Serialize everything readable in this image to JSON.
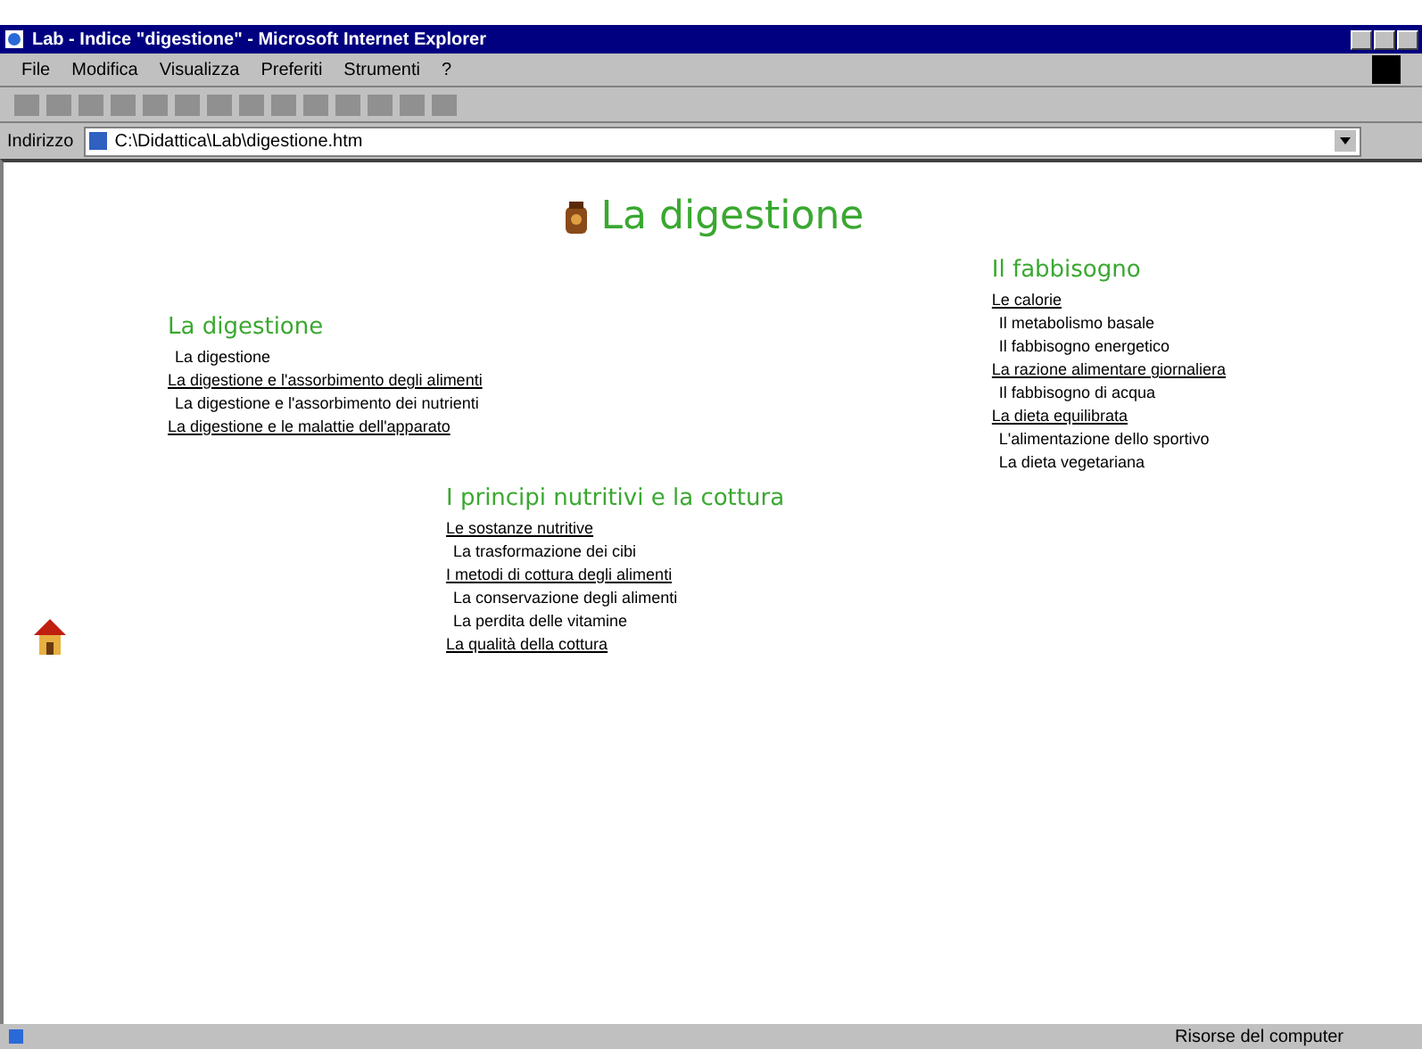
{
  "window": {
    "title": "Lab - Indice \"digestione\" - Microsoft Internet Explorer"
  },
  "menu": [
    "File",
    "Modifica",
    "Visualizza",
    "Preferiti",
    "Strumenti",
    "?"
  ],
  "address_bar": {
    "label": "Indirizzo",
    "value": "C:\\Didattica\\Lab\\digestione.htm"
  },
  "page_title": "La digestione",
  "sections": [
    {
      "title": "La digestione",
      "items": [
        {
          "text": "La digestione",
          "link": false
        },
        {
          "text": "La digestione e l'assorbimento degli alimenti",
          "link": true
        },
        {
          "text": "La digestione e l'assorbimento dei nutrienti",
          "link": false
        },
        {
          "text": "La digestione e le malattie dell'apparato",
          "link": true
        }
      ]
    },
    {
      "title": "Il fabbisogno",
      "items": [
        {
          "text": "Le calorie",
          "link": true
        },
        {
          "text": "Il metabolismo basale",
          "link": false
        },
        {
          "text": "Il fabbisogno energetico",
          "link": false
        },
        {
          "text": "La razione alimentare giornaliera",
          "link": true
        },
        {
          "text": "Il fabbisogno di acqua",
          "link": false
        },
        {
          "text": "La dieta equilibrata",
          "link": true
        },
        {
          "text": "L'alimentazione dello sportivo",
          "link": false
        },
        {
          "text": "La dieta vegetariana",
          "link": false
        }
      ]
    },
    {
      "title": "I principi nutritivi e la cottura",
      "items": [
        {
          "text": "Le sostanze nutritive",
          "link": true
        },
        {
          "text": "La trasformazione dei cibi",
          "link": false
        },
        {
          "text": "I metodi di cottura degli alimenti",
          "link": true
        },
        {
          "text": "La conservazione degli alimenti",
          "link": false
        },
        {
          "text": "La perdita delle vitamine",
          "link": false
        },
        {
          "text": "La qualità della cottura",
          "link": true
        }
      ]
    }
  ],
  "status_bar": {
    "zone": "Risorse del computer"
  }
}
